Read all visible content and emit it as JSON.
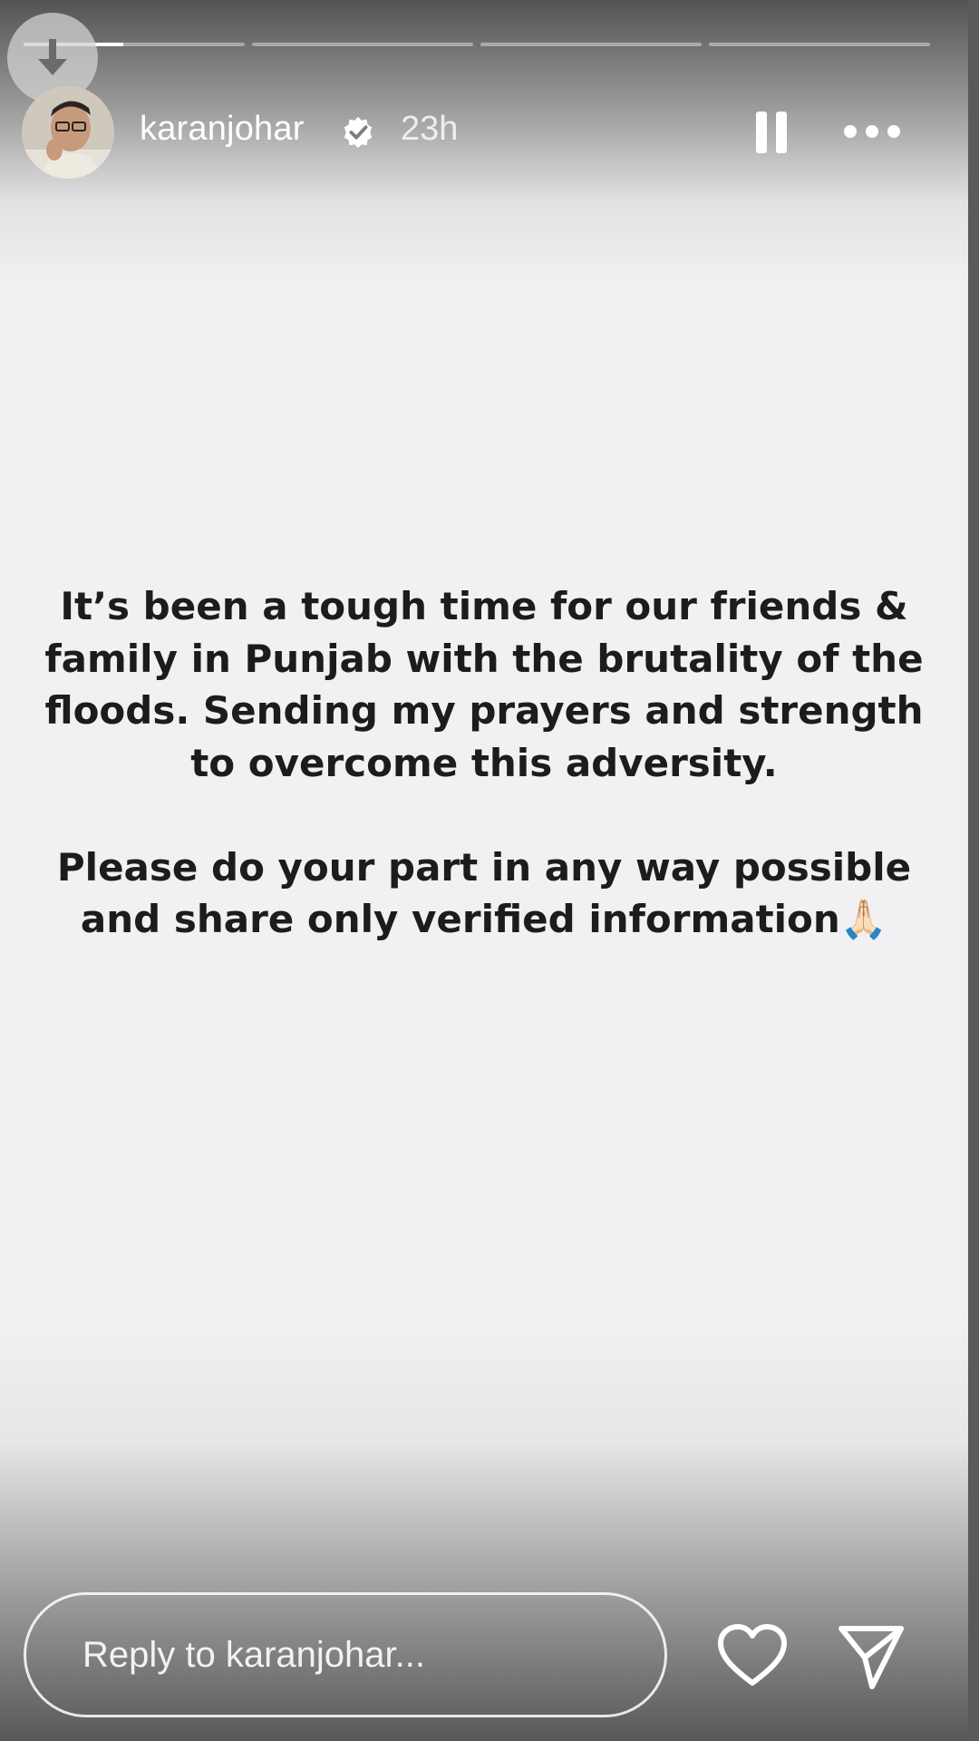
{
  "story": {
    "progress": {
      "segments": 4,
      "active_index": 0,
      "active_fill": 0.45
    },
    "header": {
      "username": "karanjohar",
      "verified": true,
      "time_ago": "23h"
    },
    "icons": {
      "download": "download-icon",
      "verified": "verified-badge-icon",
      "pause": "pause-icon",
      "more": "more-horizontal-icon",
      "like": "heart-icon",
      "share": "send-icon"
    },
    "message": {
      "paragraph1": "It’s been a tough time for our friends & family in Punjab with the brutality of the floods. Sending my prayers and strength to overcome this adversity.",
      "paragraph2": "Please do your part in any way possible and share only verified information🙏🏻"
    },
    "footer": {
      "reply_placeholder": "Reply to karanjohar..."
    },
    "colors": {
      "background": "#f1f1f3",
      "text": "#1c1c1c",
      "overlay_text": "#ffffff"
    }
  }
}
